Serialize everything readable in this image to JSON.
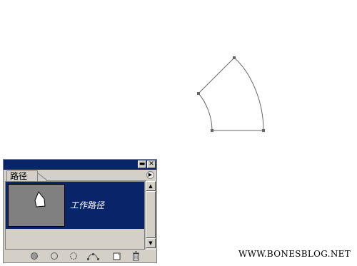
{
  "canvas": {
    "path_shape": "curved sector path with anchor points"
  },
  "panel": {
    "minimize_icon": "minimize-icon",
    "close_icon": "close-icon",
    "tab_label": "路径",
    "menu_icon": "panel-menu-arrow-icon",
    "path_item_name": "工作路径",
    "selected_color": "#0a246a",
    "footer_icons": [
      "fill-path-icon",
      "stroke-path-icon",
      "load-selection-icon",
      "make-work-path-icon",
      "new-path-icon",
      "delete-path-icon"
    ]
  },
  "watermark": "WWW.BONESBLOG.NET"
}
